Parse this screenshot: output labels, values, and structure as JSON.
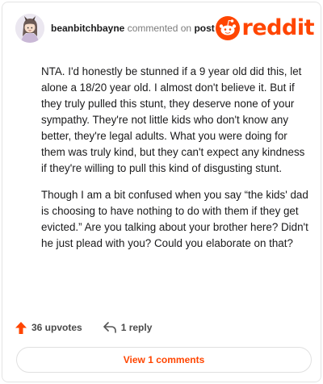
{
  "header": {
    "username": "beanbitchbayne",
    "commented_on": "commented on",
    "post": "post",
    "brand": "reddit"
  },
  "comment": {
    "paragraphs": [
      "NTA. I'd honestly be stunned if a 9 year old did this, let alone a 18/20 year old. I almost don't believe it. But if they truly pulled this stunt, they deserve none of your sympathy. They're not little kids who don't know any better, they're legal adults. What you were doing for them was truly kind, but they can't expect any kindness if they're willing to pull this kind of disgusting stunt.",
      "Though I am a bit confused when you say “the kids' dad is choosing to have nothing to do with them if they get evicted.” Are you talking about your brother here? Didn't he just plead with you? Could you elaborate on that?"
    ]
  },
  "actions": {
    "upvotes": "36 upvotes",
    "replies": "1 reply"
  },
  "footer": {
    "view_comments": "View 1 comments"
  },
  "colors": {
    "brand": "#ff4500",
    "text": "#1a1a1b",
    "muted": "#7c7c7c"
  },
  "icons": {
    "upvote": "upvote-arrow-icon",
    "reply": "reply-arrow-icon",
    "logo": "reddit-snoo-icon"
  }
}
